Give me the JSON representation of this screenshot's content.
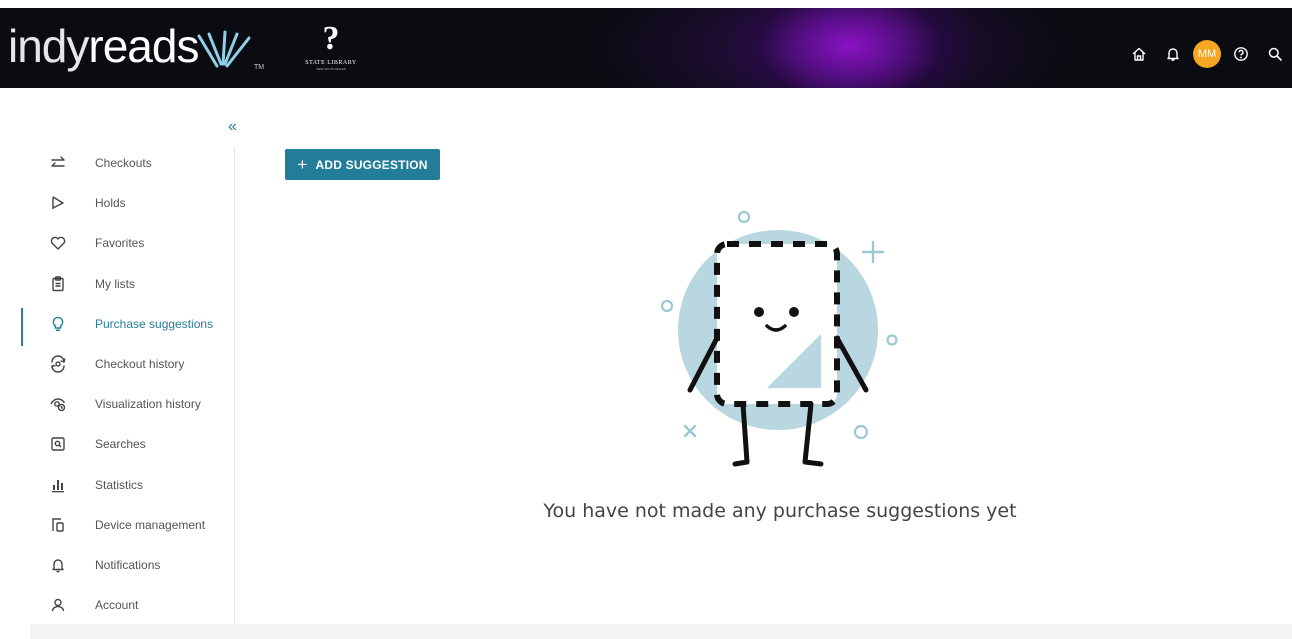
{
  "header": {
    "brand": {
      "part1": "indy",
      "part2": "reads",
      "tm": "TM"
    },
    "partner_logo": {
      "symbol": "?",
      "name": "STATE LIBRARY",
      "tagline": "NEW SOUTH WALES"
    },
    "nav": [
      {
        "icon": "home-icon"
      },
      {
        "icon": "bell-icon"
      },
      {
        "icon": "avatar",
        "initials": "MM"
      },
      {
        "icon": "help-icon"
      },
      {
        "icon": "search-icon"
      }
    ],
    "avatar_initials": "MM"
  },
  "sidebar": {
    "collapse_glyph": "«",
    "items": [
      {
        "label": "Checkouts",
        "icon": "swap-arrows-icon"
      },
      {
        "label": "Holds",
        "icon": "flag-icon"
      },
      {
        "label": "Favorites",
        "icon": "heart-icon"
      },
      {
        "label": "My lists",
        "icon": "clipboard-icon"
      },
      {
        "label": "Purchase suggestions",
        "icon": "lightbulb-icon",
        "active": true
      },
      {
        "label": "Checkout history",
        "icon": "history-icon"
      },
      {
        "label": "Visualization history",
        "icon": "eye-history-icon"
      },
      {
        "label": "Searches",
        "icon": "saved-search-icon"
      },
      {
        "label": "Statistics",
        "icon": "bar-chart-icon"
      },
      {
        "label": "Device management",
        "icon": "devices-icon"
      },
      {
        "label": "Notifications",
        "icon": "bell-icon"
      },
      {
        "label": "Account",
        "icon": "user-icon"
      }
    ]
  },
  "main": {
    "add_button": {
      "plus": "+",
      "label": "ADD SUGGESTION"
    },
    "empty_message": "You have not made any purchase suggestions yet"
  },
  "colors": {
    "accent": "#227d99",
    "active_text": "#2a7d9c",
    "avatar_bg": "#f5a623",
    "illustration_circle": "#b9d7e0"
  }
}
